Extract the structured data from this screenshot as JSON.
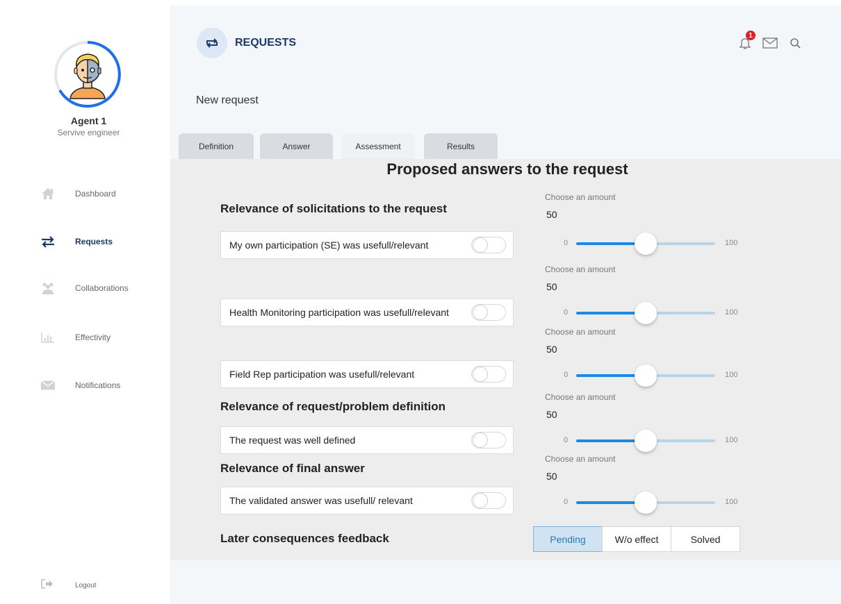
{
  "sidebar": {
    "agent_name": "Agent 1",
    "agent_role": "Servive engineer",
    "nav": [
      {
        "label": "Dashboard",
        "icon": "home-icon",
        "active": false
      },
      {
        "label": "Requests",
        "icon": "swap-arrows-icon",
        "active": true
      },
      {
        "label": "Collaborations",
        "icon": "group-icon",
        "active": false
      },
      {
        "label": "Effectivity",
        "icon": "bar-chart-icon",
        "active": false
      },
      {
        "label": "Notifications",
        "icon": "envelope-icon",
        "active": false
      }
    ],
    "logout_label": "Logout"
  },
  "header": {
    "title": "REQUESTS",
    "notification_count": "1",
    "subtitle": "New request"
  },
  "tabs": [
    "Definition",
    "Answer",
    "Assessment",
    "Results"
  ],
  "active_tab": "Assessment",
  "panel": {
    "title": "Proposed answers to the request",
    "sections": [
      "Relevance of solicitations to the request",
      "Relevance of request/problem definition",
      "Relevance of final answer",
      "Later consequences feedback"
    ],
    "questions": [
      {
        "text": "My own participation (SE) was usefull/relevant",
        "toggle_on": false
      },
      {
        "text": "Health Monitoring participation was usefull/relevant",
        "toggle_on": false
      },
      {
        "text": "Field Rep participation was usefull/relevant",
        "toggle_on": false
      },
      {
        "text": "The request was well defined",
        "toggle_on": false
      },
      {
        "text": "The validated answer was usefull/ relevant",
        "toggle_on": false
      }
    ],
    "amount_label": "Choose an amount",
    "sliders": [
      {
        "value": "50",
        "min": "0",
        "max": "100"
      },
      {
        "value": "50",
        "min": "0",
        "max": "100"
      },
      {
        "value": "50",
        "min": "0",
        "max": "100"
      },
      {
        "value": "50",
        "min": "0",
        "max": "100"
      },
      {
        "value": "50",
        "min": "0",
        "max": "100"
      }
    ],
    "feedback_options": [
      "Pending",
      "W/o effect",
      "Solved"
    ],
    "feedback_selected": "Pending"
  },
  "colors": {
    "accent": "#1e88e5",
    "brand_dark": "#1b3a6b",
    "badge": "#d9252a"
  }
}
